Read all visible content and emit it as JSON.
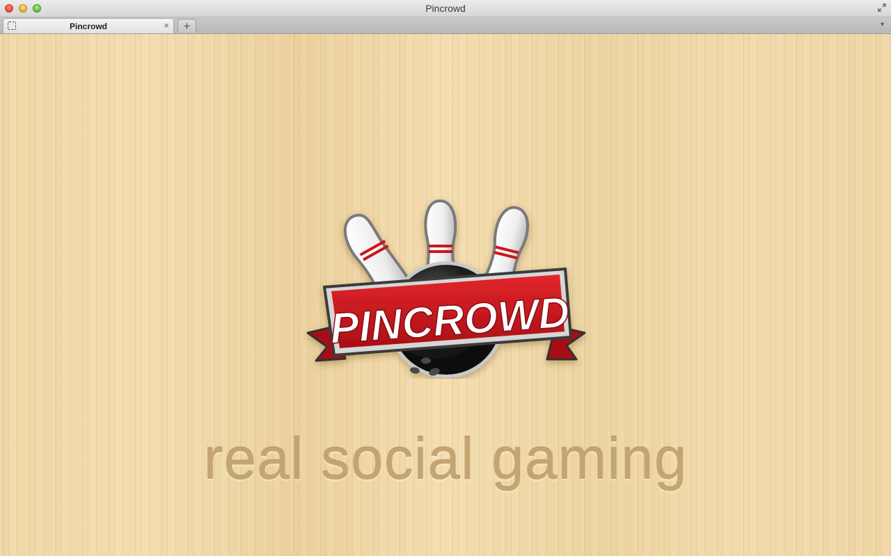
{
  "window": {
    "title": "Pincrowd",
    "controls": [
      "close",
      "minimize",
      "zoom",
      "fullscreen"
    ]
  },
  "tabs": [
    {
      "label": "Pincrowd",
      "close_symbol": "×",
      "favicon": "dashed-square-icon"
    }
  ],
  "tabbar": {
    "new_tab_symbol": "+",
    "menu_symbol": "▾"
  },
  "page": {
    "logo_text": "PINCROWD",
    "tagline": "real social gaming"
  },
  "colors": {
    "wood": "#edd4a3",
    "banner_red": "#c8161d",
    "ball": "#1a1a1a",
    "tagline": "#c4a571"
  }
}
